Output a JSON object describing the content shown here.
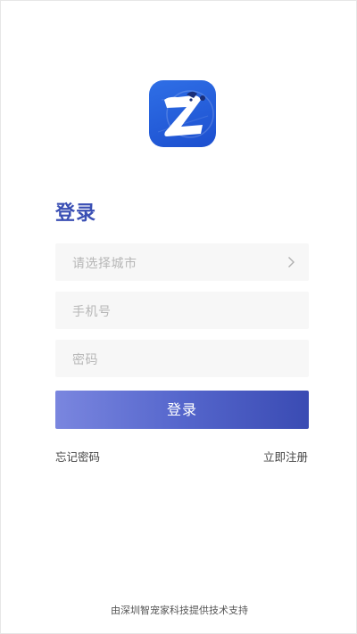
{
  "login": {
    "title": "登录",
    "city_placeholder": "请选择城市",
    "phone_placeholder": "手机号",
    "password_placeholder": "密码",
    "submit_label": "登录",
    "forgot_password": "忘记密码",
    "register": "立即注册"
  },
  "footer": {
    "text": "由深圳智宠家科技提供技术支持"
  },
  "icons": {
    "app_logo": "app-logo-icon",
    "city_chevron": "chevron-right-icon"
  },
  "colors": {
    "accent": "#3a4fb4",
    "logo_blue": "#2461dd",
    "button_gradient_start": "#7a86df",
    "button_gradient_end": "#3a4bb3",
    "field_bg": "#f7f7f7",
    "placeholder": "#b7b7b7"
  }
}
